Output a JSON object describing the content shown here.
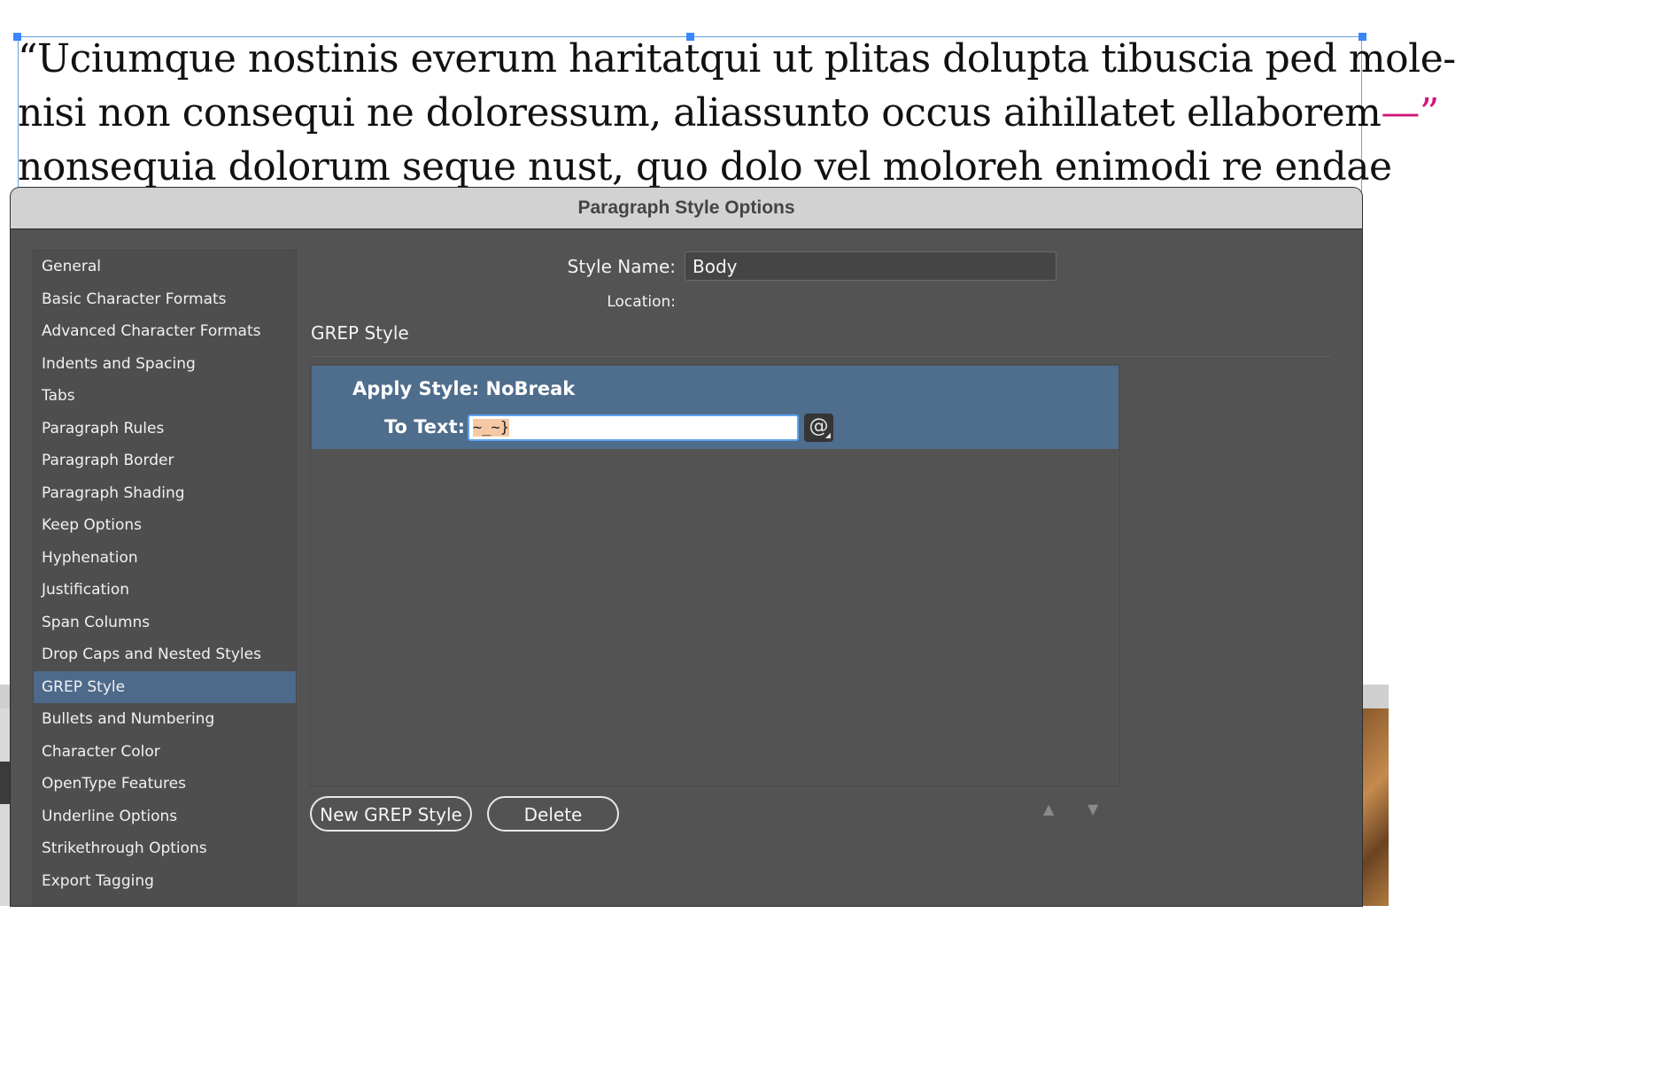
{
  "document": {
    "lines": [
      "“Uciumque nostinis everum haritatqui ut plitas dolupta tibuscia ped mole-",
      "nisi non consequi ne doloressum, aliassunto occus aihillatet ellaborem",
      "nonsequia dolorum seque nust, quo dolo vel moloreh enimodi re endae"
    ],
    "line2_tail": "—”"
  },
  "dialog": {
    "title": "Paragraph Style Options",
    "sidebar": {
      "items": [
        {
          "label": "General"
        },
        {
          "label": "Basic Character Formats"
        },
        {
          "label": "Advanced Character Formats"
        },
        {
          "label": "Indents and Spacing"
        },
        {
          "label": "Tabs"
        },
        {
          "label": "Paragraph Rules"
        },
        {
          "label": "Paragraph Border"
        },
        {
          "label": "Paragraph Shading"
        },
        {
          "label": "Keep Options"
        },
        {
          "label": "Hyphenation"
        },
        {
          "label": "Justification"
        },
        {
          "label": "Span Columns"
        },
        {
          "label": "Drop Caps and Nested Styles"
        },
        {
          "label": "GREP Style"
        },
        {
          "label": "Bullets and Numbering"
        },
        {
          "label": "Character Color"
        },
        {
          "label": "OpenType Features"
        },
        {
          "label": "Underline Options"
        },
        {
          "label": "Strikethrough Options"
        },
        {
          "label": "Export Tagging"
        }
      ],
      "selected": "GREP Style"
    },
    "style_name_label": "Style Name:",
    "style_name_value": "Body",
    "location_label": "Location:",
    "section_title": "GREP Style",
    "grep": {
      "apply_style_label": "Apply Style:",
      "apply_style_value": "NoBreak",
      "to_text_label": "To Text:",
      "to_text_value": "~_~}",
      "special_chars_icon": "@"
    },
    "new_button": "New GREP Style",
    "delete_button": "Delete",
    "move_up_icon": "▲",
    "move_down_icon": "▼"
  },
  "colors": {
    "accent": "#4f6d8c",
    "dash_color": "#d2157a",
    "dialog_bg": "#535353"
  }
}
